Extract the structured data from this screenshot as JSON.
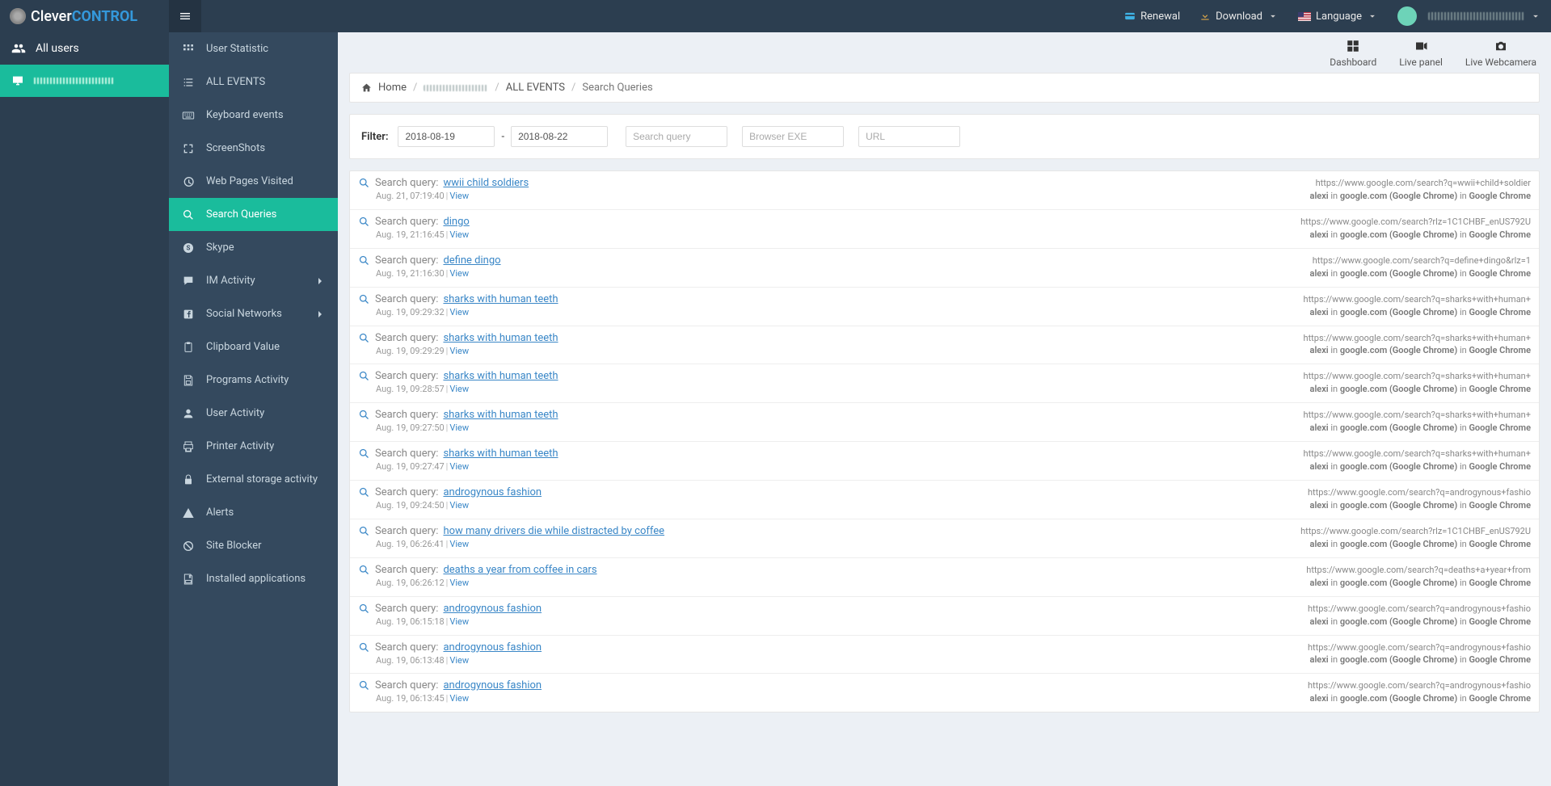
{
  "brand": {
    "part1": "Clever",
    "part2": "CONTROL"
  },
  "topbar": {
    "renewal": "Renewal",
    "download": "Download",
    "language": "Language"
  },
  "sidebar1": {
    "all_users": "All users"
  },
  "sidebar2": {
    "items": [
      {
        "label": "User Statistic",
        "icon": "grid"
      },
      {
        "label": "ALL EVENTS",
        "icon": "list"
      },
      {
        "label": "Keyboard events",
        "icon": "keyboard"
      },
      {
        "label": "ScreenShots",
        "icon": "fullscreen"
      },
      {
        "label": "Web Pages Visited",
        "icon": "history"
      },
      {
        "label": "Search Queries",
        "icon": "search",
        "active": true
      },
      {
        "label": "Skype",
        "icon": "skype"
      },
      {
        "label": "IM Activity",
        "icon": "chat",
        "expandable": true
      },
      {
        "label": "Social Networks",
        "icon": "facebook",
        "expandable": true
      },
      {
        "label": "Clipboard Value",
        "icon": "clipboard"
      },
      {
        "label": "Programs Activity",
        "icon": "save"
      },
      {
        "label": "User Activity",
        "icon": "user"
      },
      {
        "label": "Printer Activity",
        "icon": "printer"
      },
      {
        "label": "External storage activity",
        "icon": "lock"
      },
      {
        "label": "Alerts",
        "icon": "warning"
      },
      {
        "label": "Site Blocker",
        "icon": "block"
      },
      {
        "label": "Installed applications",
        "icon": "disk"
      }
    ]
  },
  "toprow": {
    "dashboard": "Dashboard",
    "livepanel": "Live panel",
    "webcam": "Live Webcamera"
  },
  "breadcrumb": {
    "home": "Home",
    "allevents": "ALL EVENTS",
    "current": "Search Queries"
  },
  "filter": {
    "label": "Filter:",
    "date_from": "2018-08-19",
    "date_to": "2018-08-22",
    "dash": "-",
    "ph_query": "Search query",
    "ph_browser": "Browser EXE",
    "ph_url": "URL"
  },
  "row_common": {
    "label": "Search query:",
    "view": "View",
    "user": "alexi",
    "in": "in",
    "site": "google.com (Google Chrome)",
    "app": "Google Chrome"
  },
  "rows": [
    {
      "q": "wwii child soldiers",
      "ts": "Aug. 21, 07:19:40",
      "url": "https://www.google.com/search?q=wwii+child+soldier"
    },
    {
      "q": "dingo",
      "ts": "Aug. 19, 21:16:45",
      "url": "https://www.google.com/search?rlz=1C1CHBF_enUS792U"
    },
    {
      "q": "define dingo",
      "ts": "Aug. 19, 21:16:30",
      "url": "https://www.google.com/search?q=define+dingo&rlz=1"
    },
    {
      "q": "sharks with human teeth",
      "ts": "Aug. 19, 09:29:32",
      "url": "https://www.google.com/search?q=sharks+with+human+"
    },
    {
      "q": "sharks with human teeth",
      "ts": "Aug. 19, 09:29:29",
      "url": "https://www.google.com/search?q=sharks+with+human+"
    },
    {
      "q": "sharks with human teeth",
      "ts": "Aug. 19, 09:28:57",
      "url": "https://www.google.com/search?q=sharks+with+human+"
    },
    {
      "q": "sharks with human teeth",
      "ts": "Aug. 19, 09:27:50",
      "url": "https://www.google.com/search?q=sharks+with+human+"
    },
    {
      "q": "sharks with human teeth",
      "ts": "Aug. 19, 09:27:47",
      "url": "https://www.google.com/search?q=sharks+with+human+"
    },
    {
      "q": "androgynous fashion",
      "ts": "Aug. 19, 09:24:50",
      "url": "https://www.google.com/search?q=androgynous+fashio"
    },
    {
      "q": "how many drivers die while distracted by coffee",
      "ts": "Aug. 19, 06:26:41",
      "url": "https://www.google.com/search?rlz=1C1CHBF_enUS792U"
    },
    {
      "q": "deaths a year from coffee in cars",
      "ts": "Aug. 19, 06:26:12",
      "url": "https://www.google.com/search?q=deaths+a+year+from"
    },
    {
      "q": "androgynous fashion",
      "ts": "Aug. 19, 06:15:18",
      "url": "https://www.google.com/search?q=androgynous+fashio"
    },
    {
      "q": "androgynous fashion",
      "ts": "Aug. 19, 06:13:48",
      "url": "https://www.google.com/search?q=androgynous+fashio"
    },
    {
      "q": "androgynous fashion",
      "ts": "Aug. 19, 06:13:45",
      "url": "https://www.google.com/search?q=androgynous+fashio"
    }
  ]
}
